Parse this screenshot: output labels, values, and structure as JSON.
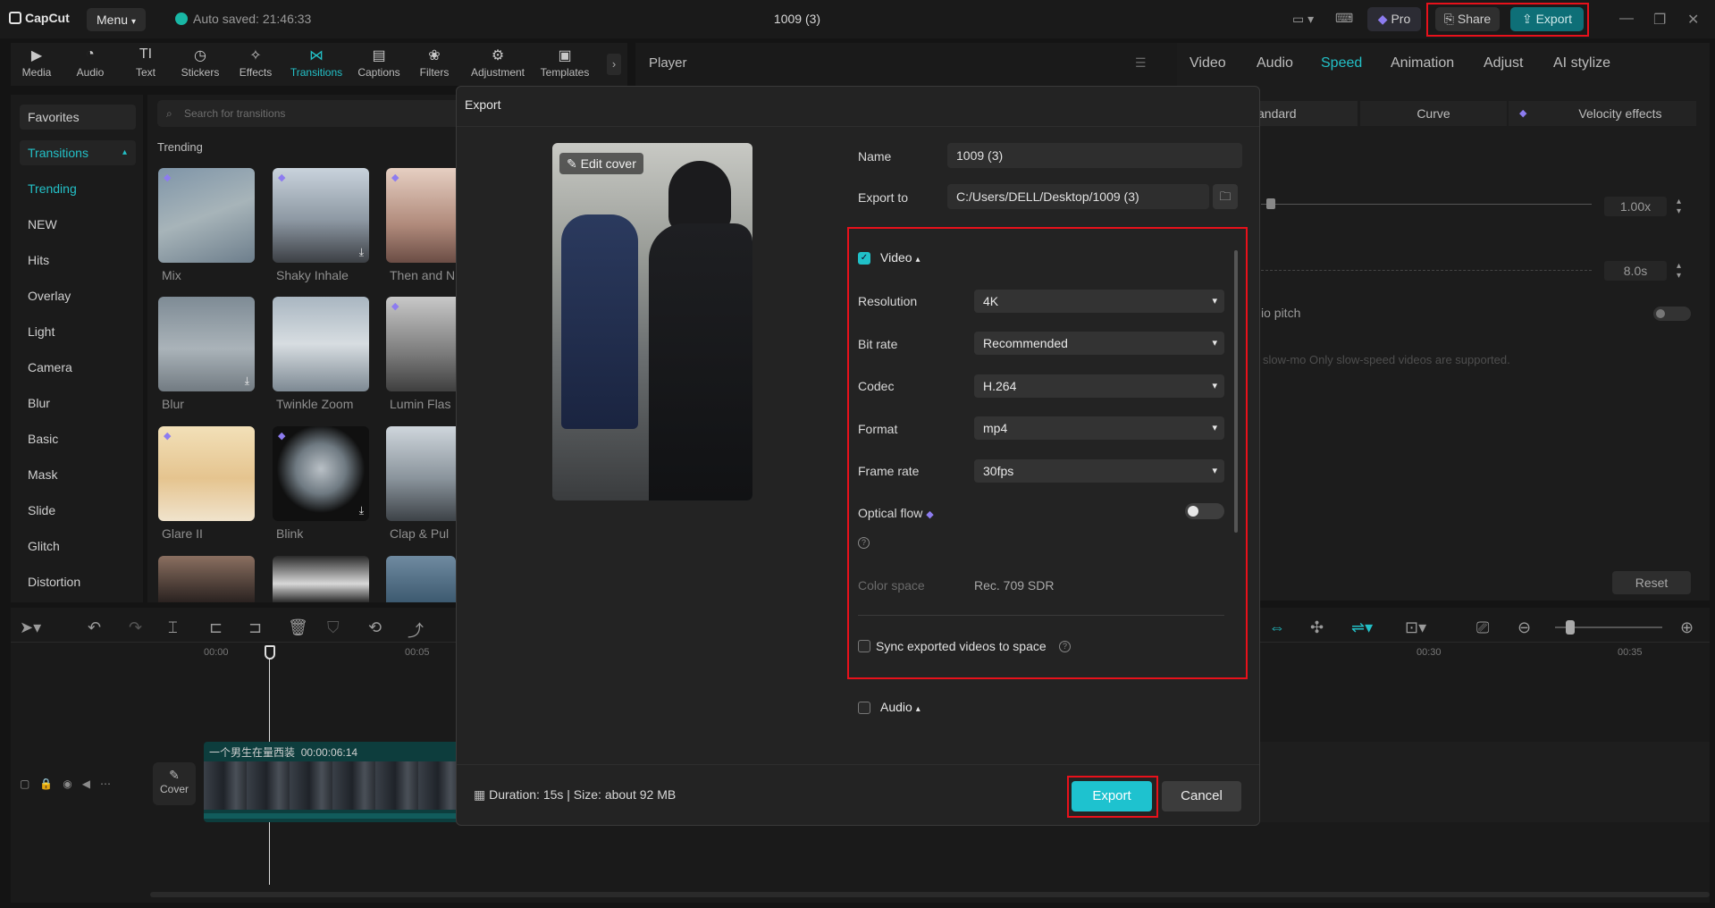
{
  "titlebar": {
    "app_name": "CapCut",
    "menu_label": "Menu",
    "autosave": "Auto saved: 21:46:33",
    "project_title": "1009 (3)",
    "pro_label": "Pro",
    "share_label": "Share",
    "export_label": "Export"
  },
  "toolbar": {
    "items": [
      {
        "label": "Media",
        "icon": "media-icon"
      },
      {
        "label": "Audio",
        "icon": "audio-icon"
      },
      {
        "label": "Text",
        "icon": "text-icon"
      },
      {
        "label": "Stickers",
        "icon": "stickers-icon"
      },
      {
        "label": "Effects",
        "icon": "effects-icon"
      },
      {
        "label": "Transitions",
        "icon": "transitions-icon"
      },
      {
        "label": "Captions",
        "icon": "captions-icon"
      },
      {
        "label": "Filters",
        "icon": "filters-icon"
      },
      {
        "label": "Adjustment",
        "icon": "adjustment-icon"
      },
      {
        "label": "Templates",
        "icon": "templates-icon"
      }
    ],
    "active": "Transitions"
  },
  "categories": {
    "favorites": "Favorites",
    "transitions": "Transitions",
    "items": [
      "Trending",
      "NEW",
      "Hits",
      "Overlay",
      "Light",
      "Camera",
      "Blur",
      "Basic",
      "Mask",
      "Slide",
      "Glitch",
      "Distortion"
    ]
  },
  "transitions_panel": {
    "search_placeholder": "Search for transitions",
    "section_title": "Trending",
    "items": [
      "Mix",
      "Shaky Inhale",
      "Then and N",
      "Blur",
      "Twinkle Zoom",
      "Lumin Flas",
      "Glare II",
      "Blink",
      "Clap & Pul"
    ]
  },
  "player": {
    "title": "Player"
  },
  "right_panel": {
    "tabs": [
      "Video",
      "Audio",
      "Speed",
      "Animation",
      "Adjust",
      "AI stylize"
    ],
    "active_tab": "Speed",
    "speed_modes": [
      "andard",
      "Curve",
      "Velocity effects"
    ],
    "speed_value": "1.00x",
    "duration_value": "8.0s",
    "pitch_label": "io pitch",
    "slowmo_note": "slow-mo  Only slow-speed videos are supported.",
    "reset_label": "Reset"
  },
  "timeline": {
    "ruler": [
      "00:00",
      "00:05",
      "00:30",
      "00:35"
    ],
    "clip_name": "一个男生在量西装",
    "clip_duration": "00:00:06:14",
    "cover_label": "Cover"
  },
  "export_dialog": {
    "title": "Export",
    "edit_cover": "Edit cover",
    "name_label": "Name",
    "name_value": "1009 (3)",
    "export_to_label": "Export to",
    "export_to_value": "C:/Users/DELL/Desktop/1009 (3)",
    "video_label": "Video",
    "resolution_label": "Resolution",
    "resolution_value": "4K",
    "bitrate_label": "Bit rate",
    "bitrate_value": "Recommended",
    "codec_label": "Codec",
    "codec_value": "H.264",
    "format_label": "Format",
    "format_value": "mp4",
    "framerate_label": "Frame rate",
    "framerate_value": "30fps",
    "optical_flow_label": "Optical flow",
    "color_space_label": "Color space",
    "color_space_value": "Rec. 709 SDR",
    "sync_label": "Sync exported videos to space",
    "audio_label": "Audio",
    "footer_info": "Duration: 15s | Size: about 92 MB",
    "export_button": "Export",
    "cancel_button": "Cancel"
  },
  "colors": {
    "accent": "#1ec2cf",
    "highlight": "#e8111b"
  }
}
